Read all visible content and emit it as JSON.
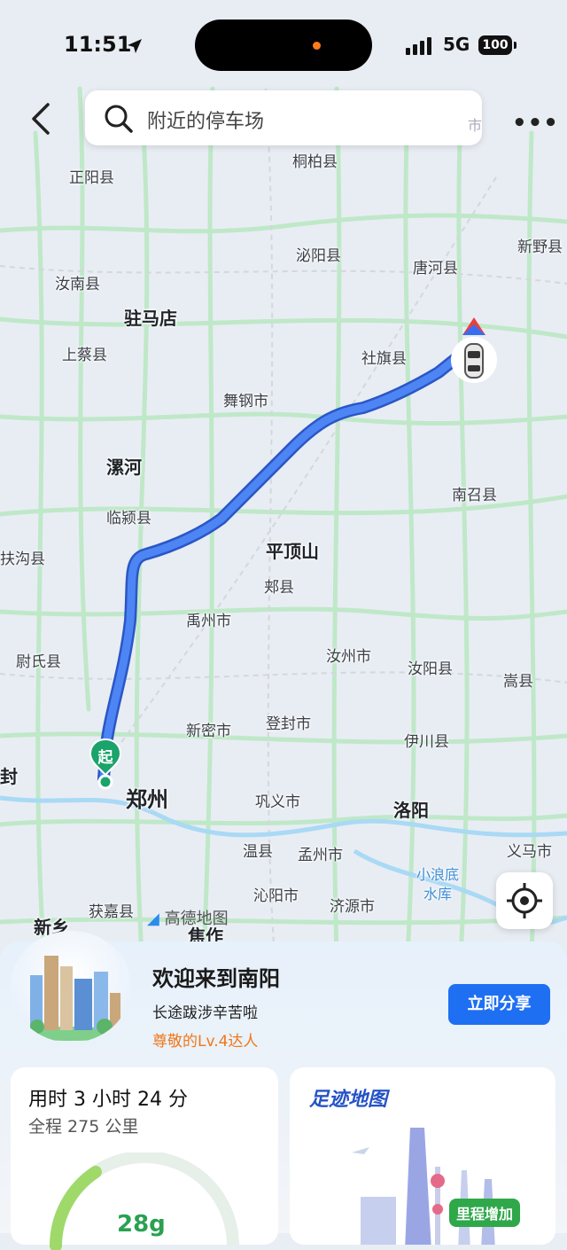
{
  "status_bar": {
    "time": "11:51",
    "network": "5G",
    "battery": "100"
  },
  "search": {
    "placeholder": "附近的停车场",
    "partial_right": "市"
  },
  "map": {
    "cities": [
      {
        "key": "zhengyang",
        "label": "正阳县"
      },
      {
        "key": "tongbai",
        "label": "桐柏县"
      },
      {
        "key": "biyang",
        "label": "泌阳县"
      },
      {
        "key": "tanghe",
        "label": "唐河县"
      },
      {
        "key": "xinye",
        "label": "新野县"
      },
      {
        "key": "runan",
        "label": "汝南县"
      },
      {
        "key": "zhumadian",
        "label": "驻马店"
      },
      {
        "key": "shangcai",
        "label": "上蔡县"
      },
      {
        "key": "sheqi",
        "label": "社旗县"
      },
      {
        "key": "wugang",
        "label": "舞钢市"
      },
      {
        "key": "luohe",
        "label": "漯河"
      },
      {
        "key": "linying",
        "label": "临颍县"
      },
      {
        "key": "nanzhao",
        "label": "南召县"
      },
      {
        "key": "fugou",
        "label": "扶沟县"
      },
      {
        "key": "pingdingshan",
        "label": "平顶山"
      },
      {
        "key": "jiaxian",
        "label": "郏县"
      },
      {
        "key": "yuzhou",
        "label": "禹州市"
      },
      {
        "key": "weishi",
        "label": "尉氏县"
      },
      {
        "key": "ruzhou",
        "label": "汝州市"
      },
      {
        "key": "ruyang",
        "label": "汝阳县"
      },
      {
        "key": "songxian",
        "label": "嵩县"
      },
      {
        "key": "xinmi",
        "label": "新密市"
      },
      {
        "key": "dengfeng",
        "label": "登封市"
      },
      {
        "key": "yichuan",
        "label": "伊川县"
      },
      {
        "key": "kaifeng_partial",
        "label": "封"
      },
      {
        "key": "zhengzhou",
        "label": "郑州"
      },
      {
        "key": "gongyi",
        "label": "巩义市"
      },
      {
        "key": "luoyang",
        "label": "洛阳"
      },
      {
        "key": "wenxian",
        "label": "温县"
      },
      {
        "key": "mengzhou",
        "label": "孟州市"
      },
      {
        "key": "yima",
        "label": "义马市"
      },
      {
        "key": "xiaolangdi",
        "label": "小浪底\n水库"
      },
      {
        "key": "huojia",
        "label": "获嘉县"
      },
      {
        "key": "qinyang",
        "label": "沁阳市"
      },
      {
        "key": "jiyuan",
        "label": "济源市"
      },
      {
        "key": "xinxiang",
        "label": "新乡"
      },
      {
        "key": "jiaozuo",
        "label": "焦作"
      }
    ],
    "start_marker": "起",
    "watermark": "高德地图",
    "route_color": "#3b6ff0"
  },
  "summary": {
    "welcome": "欢迎来到南阳",
    "subtitle": "长途跋涉辛苦啦",
    "level": "尊敬的Lv.4达人",
    "share_button": "立即分享"
  },
  "trip": {
    "duration": "用时 3 小时 24 分",
    "distance": "全程 275 公里",
    "gauge_value": "28g"
  },
  "footprint": {
    "title": "足迹地图",
    "badge": "里程增加"
  }
}
